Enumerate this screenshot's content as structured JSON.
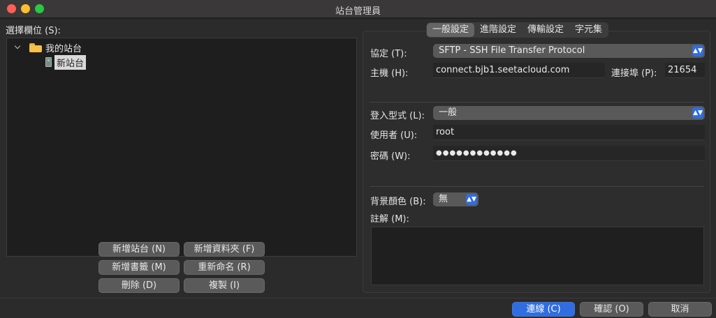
{
  "window": {
    "title": "站台管理員"
  },
  "left": {
    "select_label": "選擇欄位 (S):",
    "tree": {
      "folder": "我的站台",
      "site": "新站台"
    },
    "buttons": {
      "new_site": "新增站台 (N)",
      "new_folder": "新增資料夾 (F)",
      "new_bookmark": "新增書籤 (M)",
      "rename": "重新命名 (R)",
      "delete": "刪除 (D)",
      "duplicate": "複製 (I)"
    }
  },
  "tabs": [
    "一般設定",
    "進階設定",
    "傳輸設定",
    "字元集"
  ],
  "general": {
    "protocol_label": "協定 (T):",
    "protocol_value": "SFTP - SSH File Transfer Protocol",
    "host_label": "主機 (H):",
    "host_value": "connect.bjb1.seetacloud.com",
    "port_label": "連接埠 (P):",
    "port_value": "21654",
    "logon_label": "登入型式 (L):",
    "logon_value": "一般",
    "user_label": "使用者 (U):",
    "user_value": "root",
    "password_label": "密碼 (W):",
    "password_value": "●●●●●●●●●●●●",
    "bgcolor_label": "背景顏色 (B):",
    "bgcolor_value": "無",
    "comments_label": "註解 (M):"
  },
  "footer": {
    "connect": "連線 (C)",
    "ok": "確認 (O)",
    "cancel": "取消"
  },
  "colors": {
    "accent": "#2f6de0",
    "close": "#ff5f57",
    "minimize": "#febc2e",
    "maximize": "#28c840"
  }
}
